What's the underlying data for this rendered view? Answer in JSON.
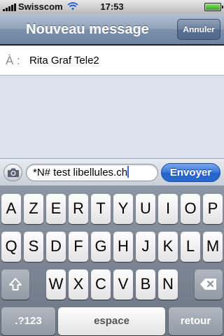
{
  "status_bar": {
    "carrier": "Swisscom",
    "time": "17:53",
    "icons": [
      "signal-icon",
      "wifi-icon",
      "battery-icon"
    ],
    "battery_level": 1.0
  },
  "nav_bar": {
    "title": "Nouveau message",
    "cancel_label": "Annuler"
  },
  "recipient": {
    "label": "À :",
    "value": "Rita Graf Tele2"
  },
  "compose": {
    "camera_icon": "camera-icon",
    "message_value": "*N# test libellules.ch",
    "send_label": "Envoyer"
  },
  "keyboard": {
    "row1": [
      "A",
      "Z",
      "E",
      "R",
      "T",
      "Y",
      "U",
      "I",
      "O",
      "P"
    ],
    "row2": [
      "Q",
      "S",
      "D",
      "F",
      "G",
      "H",
      "J",
      "K",
      "L",
      "M"
    ],
    "row3": [
      "W",
      "X",
      "C",
      "V",
      "B",
      "N"
    ],
    "shift_icon": "shift-icon",
    "delete_icon": "backspace-icon",
    "numbers_label": ".?123",
    "space_label": "espace",
    "return_label": "retour"
  },
  "colors": {
    "nav_bar": "#8fa1b8",
    "send_button": "#2f6fd3",
    "thread_background": "#dbe2ed",
    "keyboard_background": "#7d8794"
  }
}
